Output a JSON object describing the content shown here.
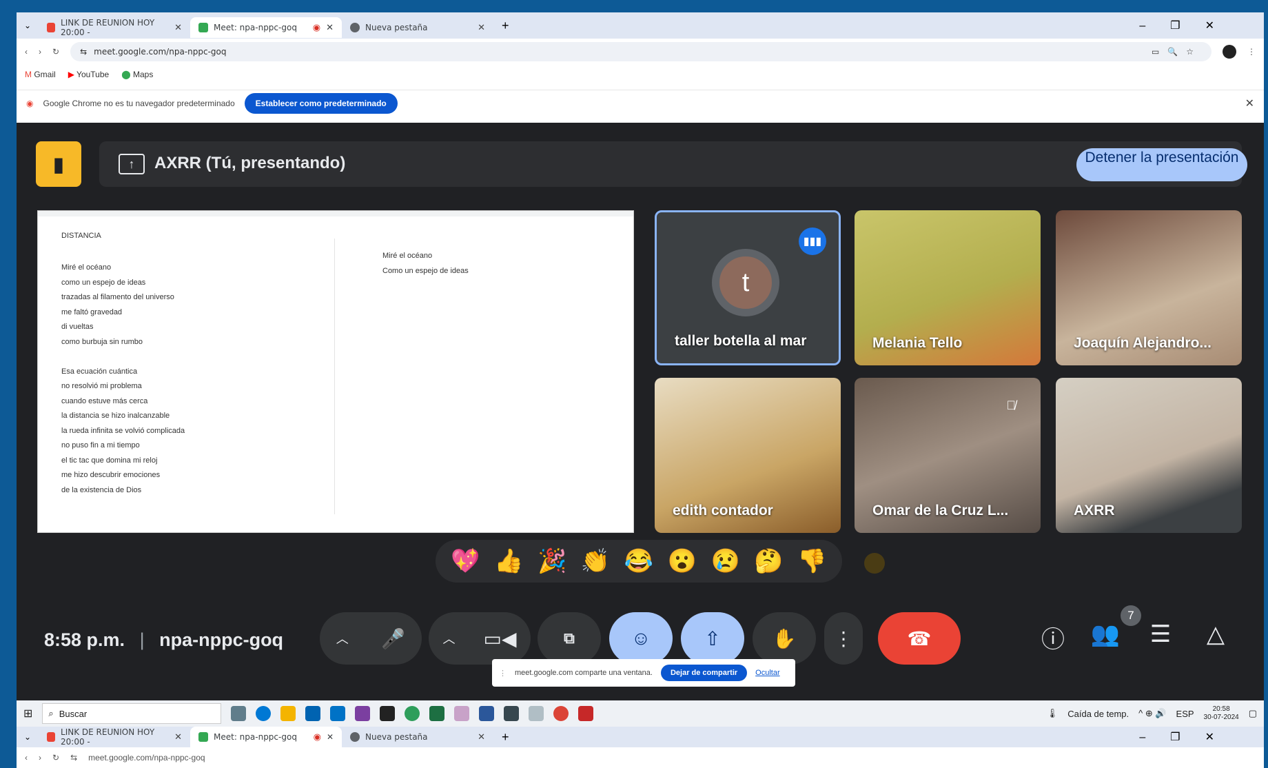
{
  "browser": {
    "tabs": [
      {
        "label": "LINK DE REUNION HOY 20:00 -",
        "icon": "gmail-icon",
        "active": false
      },
      {
        "label": "Meet: npa-nppc-goq",
        "icon": "meet-icon",
        "active": true
      },
      {
        "label": "Nueva pestaña",
        "icon": "chrome-icon",
        "active": false
      }
    ],
    "url": "meet.google.com/npa-nppc-goq",
    "bookmarks": [
      "Gmail",
      "YouTube",
      "Maps"
    ],
    "infobar_text": "Google Chrome no es tu navegador predeterminado",
    "infobar_button": "Establecer como predeterminado"
  },
  "meet": {
    "presenting_title": "AXRR (Tú, presentando)",
    "stop_button": "Detener la presentación",
    "shared_doc": {
      "title": "DISTANCIA",
      "left_lines": [
        "Miré el océano",
        "como un espejo de ideas",
        "trazadas al filamento del universo",
        "me faltó gravedad",
        "di vueltas",
        "como burbuja sin rumbo",
        "",
        "Esa ecuación cuántica",
        "no resolvió mi problema",
        "cuando estuve más cerca",
        "la distancia se hizo inalcanzable",
        "la rueda infinita se volvió complicada",
        "no puso fin a mi tiempo",
        "el tic tac que domina mi reloj",
        "me hizo descubrir emociones",
        "de la existencia de Dios"
      ],
      "right_lines": [
        "Miré el océano",
        "Como un espejo de ideas"
      ]
    },
    "participants": [
      {
        "name": "taller botella al mar",
        "initial": "t",
        "speaking": true
      },
      {
        "name": "Melania Tello"
      },
      {
        "name": "Joaquín Alejandro..."
      },
      {
        "name": "edith contador"
      },
      {
        "name": "Omar de la Cruz L...",
        "muted": true
      },
      {
        "name": "AXRR"
      }
    ],
    "reactions": [
      "💖",
      "👍",
      "🎉",
      "👏",
      "😂",
      "😮",
      "😢",
      "🤔",
      "👎"
    ],
    "clock": "8:58 p.m.",
    "meeting_code": "npa-nppc-goq",
    "share_banner": {
      "text": "meet.google.com comparte una ventana.",
      "stop": "Dejar de compartir",
      "hide": "Ocultar"
    },
    "people_count": "7",
    "colors": {
      "end_call": "#ea4335",
      "active_control": "#a8c7fa",
      "logo": "#f7b928"
    }
  },
  "taskbar": {
    "search_placeholder": "Buscar",
    "weather": "Caída de temp.",
    "lang": "ESP",
    "time": "20:58",
    "date": "30-07-2024"
  }
}
